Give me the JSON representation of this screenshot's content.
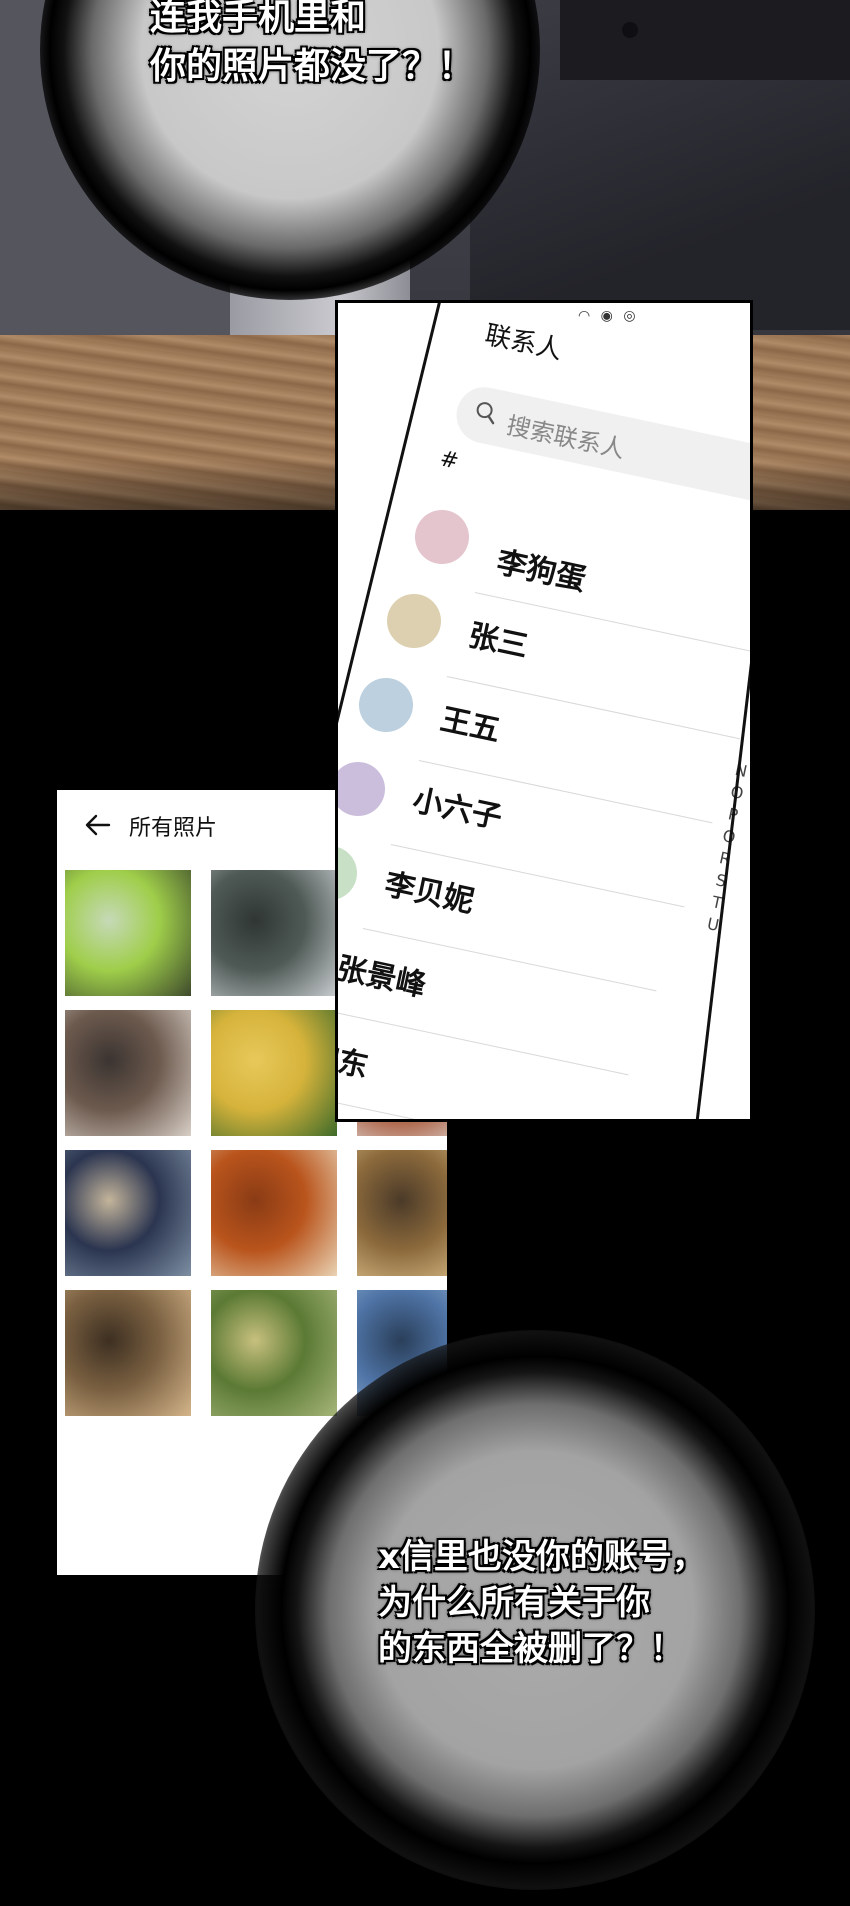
{
  "bubbles": {
    "top": [
      "连我手机里和",
      "你的照片都没了？！"
    ],
    "bottom": [
      "x信里也没你的账号，",
      "为什么所有关于你",
      "的东西全被删了？！"
    ]
  },
  "gallery": {
    "title": "所有照片",
    "back_icon": "arrow-left-icon",
    "photos": [
      {
        "colors": [
          "#9fce4a",
          "#3e4a2c",
          "#c6d9b8"
        ]
      },
      {
        "colors": [
          "#4f5a56",
          "#c9cdd0",
          "#2f3633"
        ]
      },
      {
        "colors": [
          "#e8e3cf",
          "#cfc6a4",
          "#f4f0e2"
        ]
      },
      {
        "colors": [
          "#6d5a4e",
          "#d8cfc6",
          "#3b3431"
        ]
      },
      {
        "colors": [
          "#d6b33b",
          "#3d6a2a",
          "#e7c95a"
        ]
      },
      {
        "colors": [
          "#a34c2a",
          "#e2e2e2",
          "#5b3a2a"
        ]
      },
      {
        "colors": [
          "#2b3550",
          "#7d8fa3",
          "#c4b59b"
        ]
      },
      {
        "colors": [
          "#b9541c",
          "#e9d3b4",
          "#8a3b15"
        ]
      },
      {
        "colors": [
          "#8c6a3c",
          "#e4c993",
          "#4b3a28"
        ]
      },
      {
        "colors": [
          "#7a6041",
          "#d4b58a",
          "#3d2f21"
        ]
      },
      {
        "colors": [
          "#5b7a34",
          "#a7b67a",
          "#c8c07e"
        ]
      },
      {
        "colors": [
          "#4f74a6",
          "#a4c2dd",
          "#2a3f5a"
        ]
      }
    ]
  },
  "contacts": {
    "title": "联系人",
    "search_placeholder": "搜索联系人",
    "search_icon": "search-icon",
    "section": "#",
    "people": [
      {
        "name": "李狗蛋",
        "color": "#e4c5cd"
      },
      {
        "name": "张三",
        "color": "#ddd0b0"
      },
      {
        "name": "王五",
        "color": "#bcd0df"
      },
      {
        "name": "小六子",
        "color": "#cbbddc"
      },
      {
        "name": "李贝妮",
        "color": "#c8e0c6"
      },
      {
        "name": "张景峰",
        "color": ""
      },
      {
        "name": "宇东",
        "color": ""
      }
    ],
    "alphabet": [
      "N",
      "O",
      "P",
      "Q",
      "R",
      "S",
      "T",
      "U"
    ]
  }
}
